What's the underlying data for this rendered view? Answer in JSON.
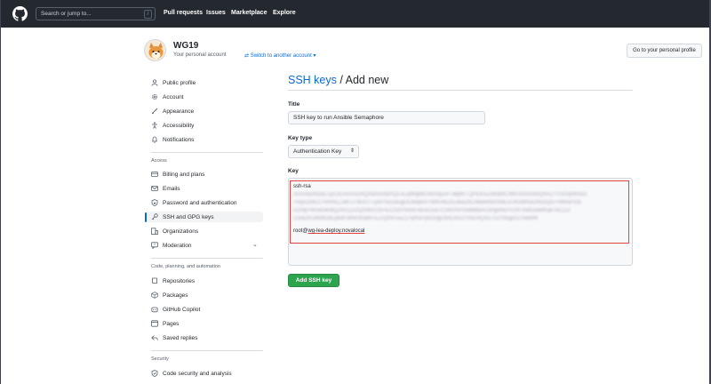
{
  "header": {
    "search_placeholder": "Search or jump to...",
    "slash_key": "/",
    "nav": [
      "Pull requests",
      "Issues",
      "Marketplace",
      "Explore"
    ]
  },
  "profile": {
    "username": "WG19",
    "subtitle": "Your personal account",
    "switch_label": "Switch to another account",
    "profile_button": "Go to your personal profile"
  },
  "sidebar": {
    "items_top": [
      {
        "label": "Public profile",
        "icon": "person-icon"
      },
      {
        "label": "Account",
        "icon": "gear-icon"
      },
      {
        "label": "Appearance",
        "icon": "paintbrush-icon"
      },
      {
        "label": "Accessibility",
        "icon": "accessibility-icon"
      },
      {
        "label": "Notifications",
        "icon": "bell-icon"
      }
    ],
    "access_heading": "Access",
    "items_access": [
      {
        "label": "Billing and plans",
        "icon": "credit-card-icon"
      },
      {
        "label": "Emails",
        "icon": "mail-icon"
      },
      {
        "label": "Password and authentication",
        "icon": "shield-lock-icon"
      },
      {
        "label": "SSH and GPG keys",
        "icon": "key-icon"
      },
      {
        "label": "Organizations",
        "icon": "organization-icon"
      },
      {
        "label": "Moderation",
        "icon": "report-icon"
      }
    ],
    "code_heading": "Code, planning, and automation",
    "items_code": [
      {
        "label": "Repositories",
        "icon": "repo-icon"
      },
      {
        "label": "Packages",
        "icon": "package-icon"
      },
      {
        "label": "GitHub Copilot",
        "icon": "copilot-icon"
      },
      {
        "label": "Pages",
        "icon": "browser-icon"
      },
      {
        "label": "Saved replies",
        "icon": "reply-icon"
      }
    ],
    "security_heading": "Security",
    "items_security": [
      {
        "label": "Code security and analysis",
        "icon": "shield-check-icon"
      }
    ]
  },
  "main": {
    "title_link": "SSH keys",
    "title_rest": " / Add new",
    "title_label": "Title",
    "title_value": "SSH key to run Ansible Semaphore",
    "key_type_label": "Key type",
    "key_type_value": "Authentication Key",
    "key_label": "Key",
    "key_lines": [
      "ssh-rsa",
      "AAAAB3NzaC1yc2EAAAADAQABAAABAQCvLqWfgMD34Xdyu4T3bjhKTQPEKAZ5KkBIC/MfUsOGc6oQhA2TV33SpWmzu",
      "+mpu1l9CC+RH0LL3dF2TW3U7Tj06Y5cGkugDCBwjKR7M9U4G2Cuka2lICHBwbN0004EvU4OMNuDN0DQG+WkfoP1fE",
      "G2Hp+4Ke63e/dQZhz1Zu2Q0/8nU16+EC020YkmdTeEeUuaTCVBVN+f/xdbBBA/1lRgvNu/+OXFmdGow8KqeTkC2Z/",
      "CIo4ZK1lM4fG6LpkdFWN/0IOB6+EZ/Qr0i+uuZ1+phSl+jhDOgU9ALKG1YmCRQ0u7S2YbsgiX27hedrM"
    ],
    "key_user": "root@",
    "key_host": "wg-lea-deploy.novalocal",
    "add_button": "Add SSH key"
  },
  "colors": {
    "header_bg": "#24292f",
    "link": "#0969da",
    "primary_button": "#2da44e",
    "highlight_border": "#e0443c"
  }
}
